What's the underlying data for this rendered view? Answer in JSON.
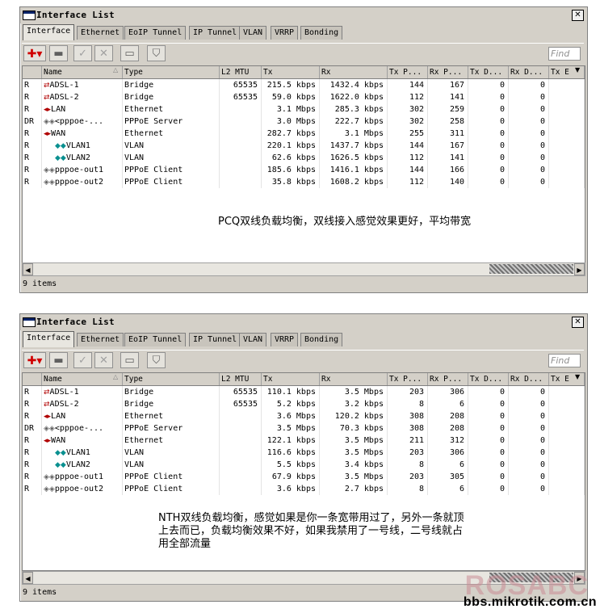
{
  "window_title": "Interface List",
  "tabs": [
    "Interface",
    "Ethernet",
    "EoIP Tunnel",
    "IP Tunnel",
    "VLAN",
    "VRRP",
    "Bonding"
  ],
  "find_placeholder": "Find",
  "columns": [
    "",
    "Name",
    "Type",
    "L2 MTU",
    "Tx",
    "Rx",
    "Tx P...",
    "Rx P...",
    "Tx D...",
    "Rx D...",
    "Tx E"
  ],
  "status_text": "9 items",
  "icon_names": [
    "add-icon",
    "remove-icon",
    "enable-icon",
    "disable-icon",
    "comment-icon",
    "filter-icon"
  ],
  "window1": {
    "rows": [
      {
        "flag": "R",
        "icon": "adsl-icon",
        "name": "ADSL-1",
        "type": "Bridge",
        "l2mtu": "65535",
        "tx": "215.5 kbps",
        "rx": "1432.4 kbps",
        "txp": "144",
        "rxp": "167",
        "txd": "0",
        "rxd": "0"
      },
      {
        "flag": "R",
        "icon": "adsl-icon",
        "name": "ADSL-2",
        "type": "Bridge",
        "l2mtu": "65535",
        "tx": "59.0 kbps",
        "rx": "1622.0 kbps",
        "txp": "112",
        "rxp": "141",
        "txd": "0",
        "rxd": "0"
      },
      {
        "flag": "R",
        "icon": "ethernet-icon",
        "name": "LAN",
        "type": "Ethernet",
        "l2mtu": "",
        "tx": "3.1 Mbps",
        "rx": "285.3 kbps",
        "txp": "302",
        "rxp": "259",
        "txd": "0",
        "rxd": "0"
      },
      {
        "flag": "DR",
        "icon": "pppoe-icon",
        "name": "<pppoe-...",
        "type": "PPPoE Server",
        "l2mtu": "",
        "tx": "3.0 Mbps",
        "rx": "222.7 kbps",
        "txp": "302",
        "rxp": "258",
        "txd": "0",
        "rxd": "0"
      },
      {
        "flag": "R",
        "icon": "ethernet-icon",
        "name": "WAN",
        "type": "Ethernet",
        "l2mtu": "",
        "tx": "282.7 kbps",
        "rx": "3.1 Mbps",
        "txp": "255",
        "rxp": "311",
        "txd": "0",
        "rxd": "0"
      },
      {
        "flag": "R",
        "icon": "vlan-icon",
        "name": "VLAN1",
        "type": "VLAN",
        "l2mtu": "",
        "tx": "220.1 kbps",
        "rx": "1437.7 kbps",
        "txp": "144",
        "rxp": "167",
        "txd": "0",
        "rxd": "0"
      },
      {
        "flag": "R",
        "icon": "vlan-icon",
        "name": "VLAN2",
        "type": "VLAN",
        "l2mtu": "",
        "tx": "62.6 kbps",
        "rx": "1626.5 kbps",
        "txp": "112",
        "rxp": "141",
        "txd": "0",
        "rxd": "0"
      },
      {
        "flag": "R",
        "icon": "pppoe-icon",
        "name": "pppoe-out1",
        "type": "PPPoE Client",
        "l2mtu": "",
        "tx": "185.6 kbps",
        "rx": "1416.1 kbps",
        "txp": "144",
        "rxp": "166",
        "txd": "0",
        "rxd": "0"
      },
      {
        "flag": "R",
        "icon": "pppoe-icon",
        "name": "pppoe-out2",
        "type": "PPPoE Client",
        "l2mtu": "",
        "tx": "35.8 kbps",
        "rx": "1608.2 kbps",
        "txp": "112",
        "rxp": "140",
        "txd": "0",
        "rxd": "0"
      }
    ],
    "note": "PCQ双线负载均衡，双线接入感觉效果更好，平均带宽"
  },
  "window2": {
    "rows": [
      {
        "flag": "R",
        "icon": "adsl-icon",
        "name": "ADSL-1",
        "type": "Bridge",
        "l2mtu": "65535",
        "tx": "110.1 kbps",
        "rx": "3.5 Mbps",
        "txp": "203",
        "rxp": "306",
        "txd": "0",
        "rxd": "0"
      },
      {
        "flag": "R",
        "icon": "adsl-icon",
        "name": "ADSL-2",
        "type": "Bridge",
        "l2mtu": "65535",
        "tx": "5.2 kbps",
        "rx": "3.2 kbps",
        "txp": "8",
        "rxp": "6",
        "txd": "0",
        "rxd": "0"
      },
      {
        "flag": "R",
        "icon": "ethernet-icon",
        "name": "LAN",
        "type": "Ethernet",
        "l2mtu": "",
        "tx": "3.6 Mbps",
        "rx": "120.2 kbps",
        "txp": "308",
        "rxp": "208",
        "txd": "0",
        "rxd": "0"
      },
      {
        "flag": "DR",
        "icon": "pppoe-icon",
        "name": "<pppoe-...",
        "type": "PPPoE Server",
        "l2mtu": "",
        "tx": "3.5 Mbps",
        "rx": "70.3 kbps",
        "txp": "308",
        "rxp": "208",
        "txd": "0",
        "rxd": "0"
      },
      {
        "flag": "R",
        "icon": "ethernet-icon",
        "name": "WAN",
        "type": "Ethernet",
        "l2mtu": "",
        "tx": "122.1 kbps",
        "rx": "3.5 Mbps",
        "txp": "211",
        "rxp": "312",
        "txd": "0",
        "rxd": "0"
      },
      {
        "flag": "R",
        "icon": "vlan-icon",
        "name": "VLAN1",
        "type": "VLAN",
        "l2mtu": "",
        "tx": "116.6 kbps",
        "rx": "3.5 Mbps",
        "txp": "203",
        "rxp": "306",
        "txd": "0",
        "rxd": "0"
      },
      {
        "flag": "R",
        "icon": "vlan-icon",
        "name": "VLAN2",
        "type": "VLAN",
        "l2mtu": "",
        "tx": "5.5 kbps",
        "rx": "3.4 kbps",
        "txp": "8",
        "rxp": "6",
        "txd": "0",
        "rxd": "0"
      },
      {
        "flag": "R",
        "icon": "pppoe-icon",
        "name": "pppoe-out1",
        "type": "PPPoE Client",
        "l2mtu": "",
        "tx": "67.9 kbps",
        "rx": "3.5 Mbps",
        "txp": "203",
        "rxp": "305",
        "txd": "0",
        "rxd": "0"
      },
      {
        "flag": "R",
        "icon": "pppoe-icon",
        "name": "pppoe-out2",
        "type": "PPPoE Client",
        "l2mtu": "",
        "tx": "3.6 kbps",
        "rx": "2.7 kbps",
        "txp": "8",
        "rxp": "6",
        "txd": "0",
        "rxd": "0"
      }
    ],
    "note": "NTH双线负载均衡，感觉如果是你一条宽带用过了，另外一条就顶\n上去而已，负载均衡效果不好，如果我禁用了一号线，二号线就占\n用全部流量"
  },
  "watermark": {
    "logo": "ROSABC",
    "url": "bbs.mikrotik.com.cn"
  }
}
